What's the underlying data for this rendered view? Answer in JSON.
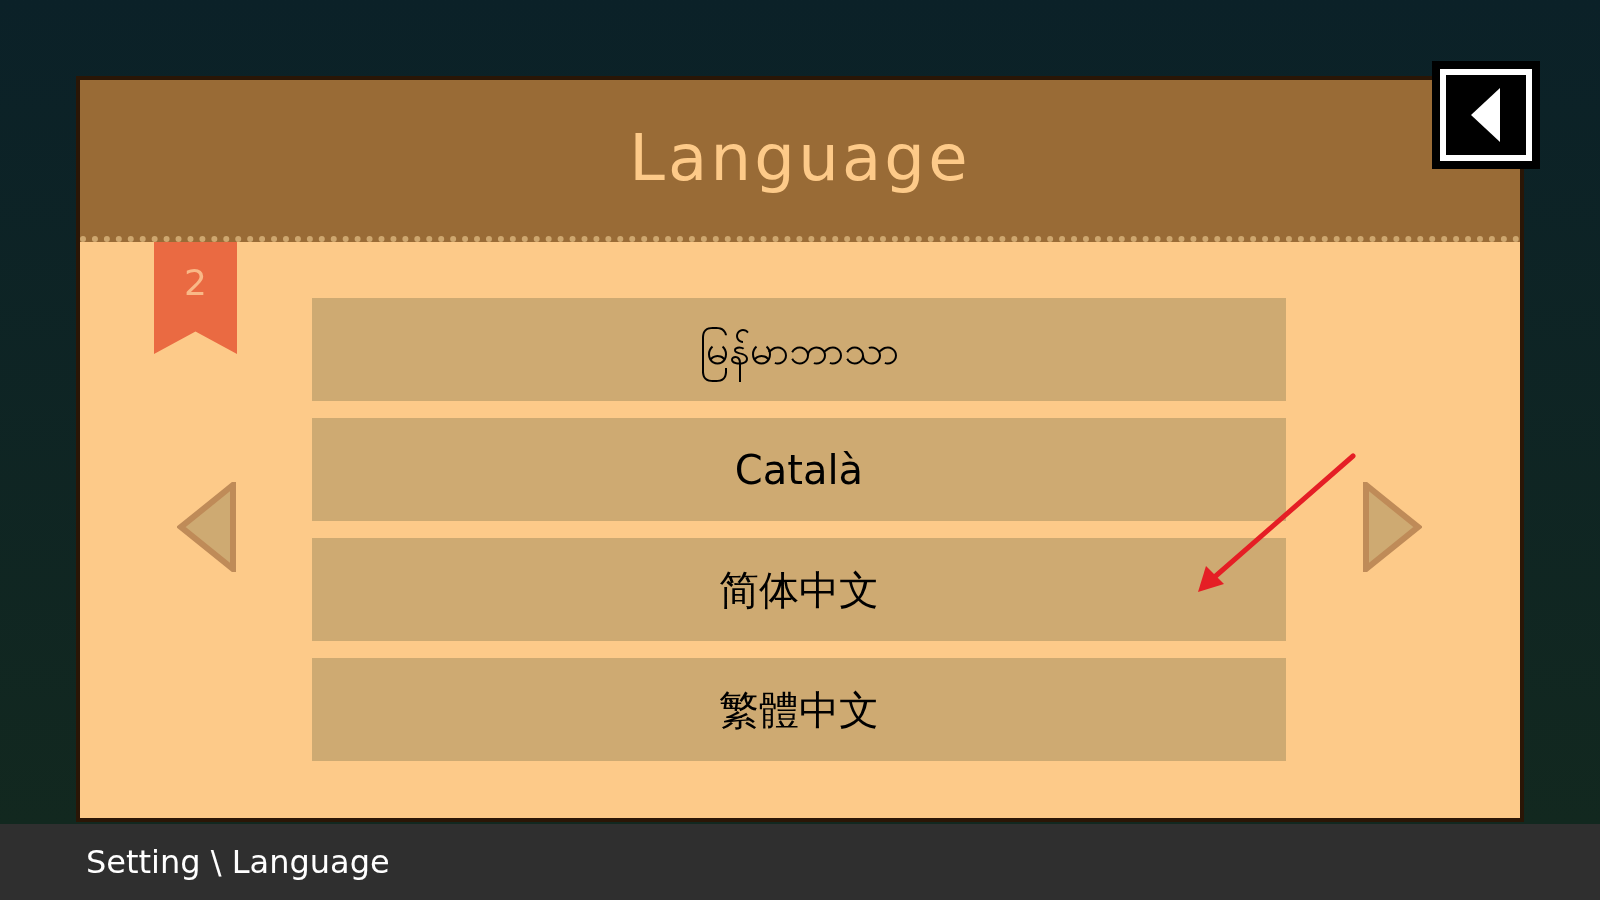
{
  "dialog": {
    "title": "Language",
    "page_number": "2",
    "languages": [
      "မြန်မာဘာသာ",
      "Català",
      "简体中文",
      "繁體中文"
    ]
  },
  "status_bar": {
    "breadcrumb": "Setting \\ Language"
  }
}
